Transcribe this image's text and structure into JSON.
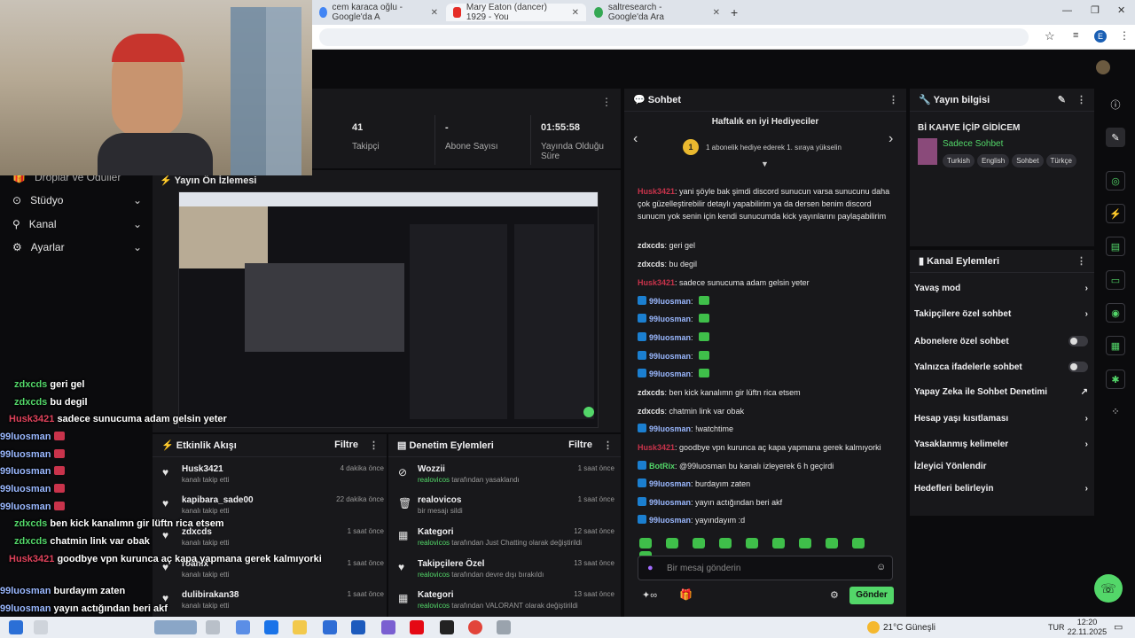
{
  "browser": {
    "tabs": [
      {
        "title": "cem karaca oğlu - Google'da A"
      },
      {
        "title": "Mary Eaton (dancer) 1929 - You"
      },
      {
        "title": "saltresearch - Google'da Ara"
      }
    ],
    "new_tab": "+",
    "profile_initial": "E"
  },
  "sidebar": {
    "items": [
      {
        "label": "Droplar ve Ödüller",
        "icon": "gift-icon"
      },
      {
        "label": "Stüdyo",
        "icon": "studio-icon"
      },
      {
        "label": "Kanal",
        "icon": "channel-icon"
      },
      {
        "label": "Ayarlar",
        "icon": "gear-icon"
      }
    ]
  },
  "stats": [
    {
      "value": "41",
      "label": "Takipçi"
    },
    {
      "value": "-",
      "label": "Abone Sayısı"
    },
    {
      "value": "01:55:58",
      "label": "Yayında Olduğu Süre"
    }
  ],
  "preview": {
    "title": "Yayın Ön İzlemesi"
  },
  "overlay_chat": [
    {
      "user": "zdxcds",
      "msg": "geri gel",
      "color": "green"
    },
    {
      "user": "zdxcds",
      "msg": "bu degil",
      "color": "green"
    },
    {
      "user": "Husk3421",
      "msg": "sadece sunucuma adam gelsin yeter",
      "color": "red"
    },
    {
      "user": "99luosman",
      "msg": "",
      "color": "blue"
    },
    {
      "user": "99luosman",
      "msg": "",
      "color": "blue"
    },
    {
      "user": "99luosman",
      "msg": "",
      "color": "blue"
    },
    {
      "user": "99luosman",
      "msg": "",
      "color": "blue"
    },
    {
      "user": "99luosman",
      "msg": "",
      "color": "blue"
    },
    {
      "user": "zdxcds",
      "msg": "ben kick kanalımn gir lüftn rica etsem",
      "color": "green"
    },
    {
      "user": "zdxcds",
      "msg": "chatmin link var obak",
      "color": "green"
    },
    {
      "user": "Husk3421",
      "msg": "goodbye vpn kurunca aç kapa yapmana gerek kalmıyorki",
      "color": "red"
    },
    {
      "user": "99luosman",
      "msg": "burdayım zaten",
      "color": "blue"
    },
    {
      "user": "99luosman",
      "msg": "yayın actığından beri akf",
      "color": "blue"
    },
    {
      "user": "99luosman",
      "msg": "yayındayım :d",
      "color": "blue"
    }
  ],
  "activity": {
    "title": "Etkinlik Akışı",
    "filter": "Filtre",
    "items": [
      {
        "name": "Husk3421",
        "sub": "kanalı takip etti",
        "time": "4 dakika önce"
      },
      {
        "name": "kapibara_sade00",
        "sub": "kanalı takip etti",
        "time": "22 dakika önce"
      },
      {
        "name": "zdxcds",
        "sub": "kanalı takip etti",
        "time": "1 saat önce"
      },
      {
        "name": "roahix",
        "sub": "kanalı takip etti",
        "time": "1 saat önce"
      },
      {
        "name": "dulibirakan38",
        "sub": "kanalı takip etti",
        "time": "1 saat önce"
      }
    ]
  },
  "moderation": {
    "title": "Denetim Eylemleri",
    "filter": "Filtre",
    "items": [
      {
        "name": "Wozzii",
        "actor": "realovicos",
        "sub": "tarafından yasaklandı",
        "time": "1 saat önce",
        "icon": "ban-icon"
      },
      {
        "name": "realovicos",
        "actor": "",
        "sub": "bir mesajı sildi",
        "time": "1 saat önce",
        "icon": "trash-icon"
      },
      {
        "name": "Kategori",
        "actor": "realovicos",
        "sub": "tarafından Just Chatting olarak değiştirildi",
        "time": "12 saat önce",
        "icon": "category-icon"
      },
      {
        "name": "Takipçilere Özel",
        "actor": "realovicos",
        "sub": "tarafından devre dışı bırakıldı",
        "time": "13 saat önce",
        "icon": "heart-icon"
      },
      {
        "name": "Kategori",
        "actor": "realovicos",
        "sub": "tarafından VALORANT olarak değiştirildi",
        "time": "13 saat önce",
        "icon": "category-icon"
      }
    ]
  },
  "chat": {
    "title": "Sohbet",
    "gifters_title": "Haftalık en iyi Hediyeciler",
    "gifters_sub": "1 abonelik hediye ederek 1. sıraya yükselin",
    "gifters_rank": "1",
    "messages": [
      {
        "user": "Husk3421",
        "msg": "yani şöyle bak şimdi discord sunucun varsa sunucunu daha çok güzelleştirebilir detaylı yapabilirim ya da dersen benim discord sunucm yok senin için kendi sunucumda kick yayınlarını paylaşabilirim",
        "color": "red"
      },
      {
        "user": "zdxcds",
        "msg": "geri gel",
        "color": "white"
      },
      {
        "user": "zdxcds",
        "msg": "bu degil",
        "color": "white"
      },
      {
        "user": "Husk3421",
        "msg": "sadece sunucuma adam gelsin yeter",
        "color": "red"
      },
      {
        "user": "99luosman",
        "msg": "",
        "color": "blue"
      },
      {
        "user": "99luosman",
        "msg": "",
        "color": "blue"
      },
      {
        "user": "99luosman",
        "msg": "",
        "color": "blue"
      },
      {
        "user": "99luosman",
        "msg": "",
        "color": "blue"
      },
      {
        "user": "99luosman",
        "msg": "",
        "color": "blue"
      },
      {
        "user": "zdxcds",
        "msg": "ben kick kanalımn gir lüftn rica etsem",
        "color": "white"
      },
      {
        "user": "zdxcds",
        "msg": "chatmin link var obak",
        "color": "white"
      },
      {
        "user": "99luosman",
        "msg": "!watchtime",
        "color": "blue"
      },
      {
        "user": "Husk3421",
        "msg": "goodbye vpn kurunca aç kapa yapmana gerek kalmıyorki",
        "color": "red"
      },
      {
        "user": "BotRix",
        "msg": "@99luosman bu kanalı izleyerek 6 h geçirdi",
        "color": "green"
      },
      {
        "user": "99luosman",
        "msg": "burdayım zaten",
        "color": "blue"
      },
      {
        "user": "99luosman",
        "msg": "yayın actığından beri akf",
        "color": "blue"
      },
      {
        "user": "99luosman",
        "msg": "yayındayım :d",
        "color": "blue"
      }
    ],
    "input_placeholder": "Bir mesaj gönderin",
    "send_label": "Gönder"
  },
  "stream_info": {
    "title": "Yayın bilgisi",
    "stream_title": "Bİ KAHVE İÇİP GİDİCEM",
    "category": "Sadece Sohbet",
    "tags": [
      "Turkish",
      "English",
      "Sohbet",
      "Türkçe"
    ]
  },
  "channel_actions": {
    "title": "Kanal Eylemleri",
    "items": [
      {
        "label": "Yavaş mod",
        "control": "chevron"
      },
      {
        "label": "Takipçilere özel sohbet",
        "control": "chevron"
      },
      {
        "label": "Abonelere özel sohbet",
        "control": "toggle"
      },
      {
        "label": "Yalnızca ifadelerle sohbet",
        "control": "toggle"
      },
      {
        "label": "Yapay Zeka ile Sohbet Denetimi",
        "control": "external"
      },
      {
        "label": "Hesap yaşı kısıtlaması",
        "control": "chevron"
      },
      {
        "label": "Yasaklanmış kelimeler",
        "control": "chevron"
      },
      {
        "label": "İzleyici Yönlendir",
        "control": "none"
      },
      {
        "label": "Hedefleri belirleyin",
        "control": "chevron"
      }
    ]
  },
  "taskbar": {
    "weather": "21°C Güneşli",
    "lang": "TUR",
    "time": "12:20",
    "date": "22.11.2025"
  },
  "colors": {
    "accent": "#53d769",
    "panel": "#18181b",
    "bg": "#0b0b0d",
    "red_user": "#c9334b"
  }
}
